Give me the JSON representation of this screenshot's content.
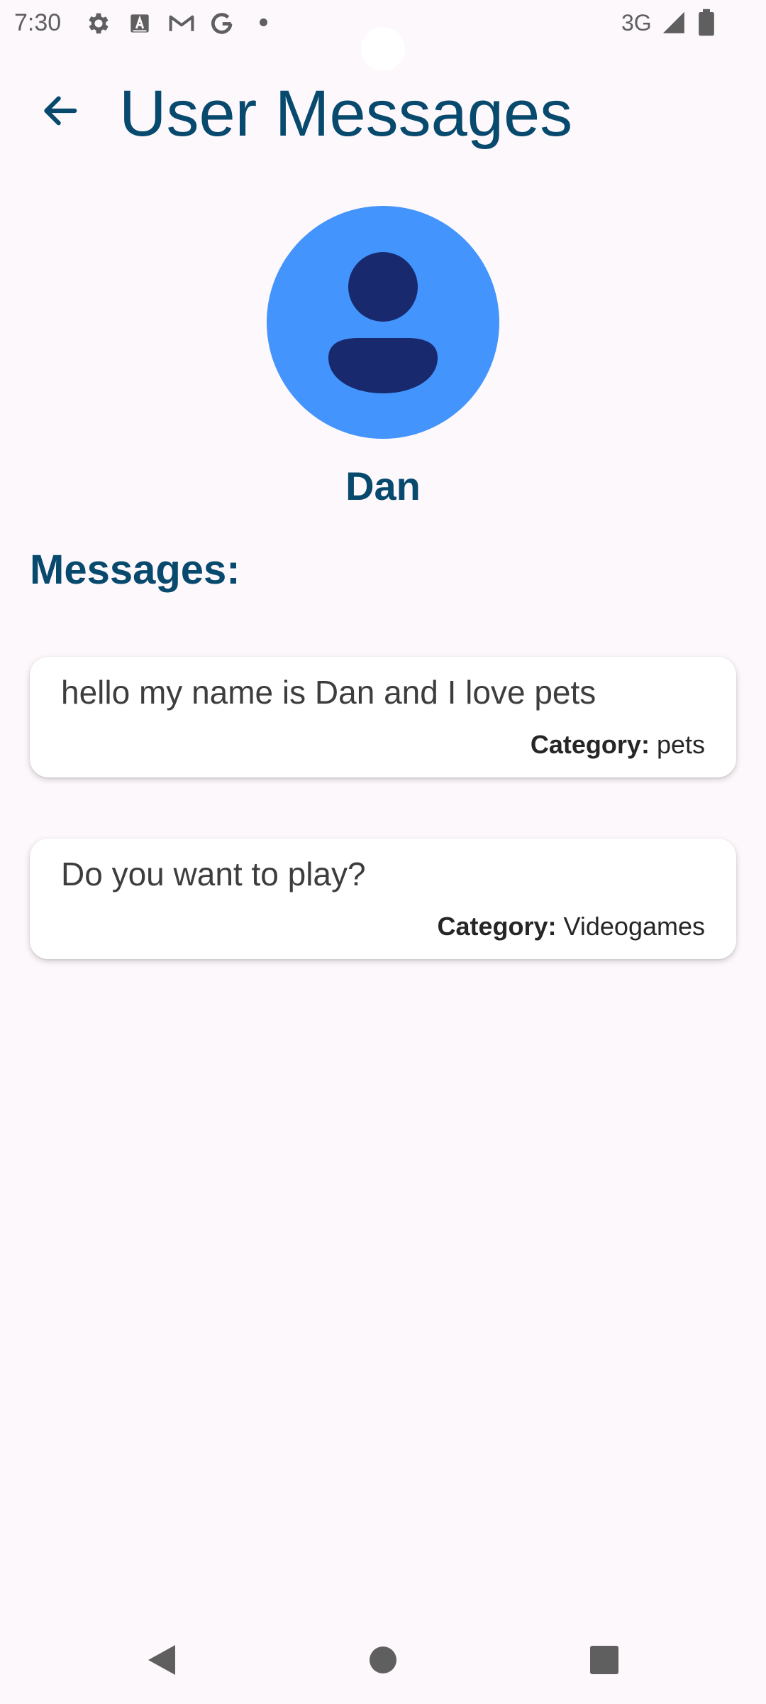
{
  "status_bar": {
    "time": "7:30",
    "network": "3G",
    "icons": [
      "gear-icon",
      "a-text-icon",
      "gmail-icon",
      "google-icon",
      "notification-dot",
      "signal-icon",
      "battery-icon"
    ]
  },
  "app_bar": {
    "title": "User Messages",
    "back_icon": "arrow-back-icon"
  },
  "profile": {
    "name": "Dan",
    "avatar_icon": "person-icon",
    "colors": {
      "avatar_bg": "#4394fd",
      "avatar_fg": "#182a6d"
    }
  },
  "messages": {
    "heading": "Messages:",
    "category_label": "Category:",
    "items": [
      {
        "text": "hello my name is Dan and I love pets",
        "category": "pets"
      },
      {
        "text": "Do you want to play?",
        "category": "Videogames"
      }
    ]
  },
  "nav_bar": {
    "buttons": [
      "back-triangle-icon",
      "home-circle-icon",
      "recents-square-icon"
    ]
  },
  "colors": {
    "accent": "#08496e",
    "background": "#fdf8fc",
    "card": "#ffffff"
  }
}
